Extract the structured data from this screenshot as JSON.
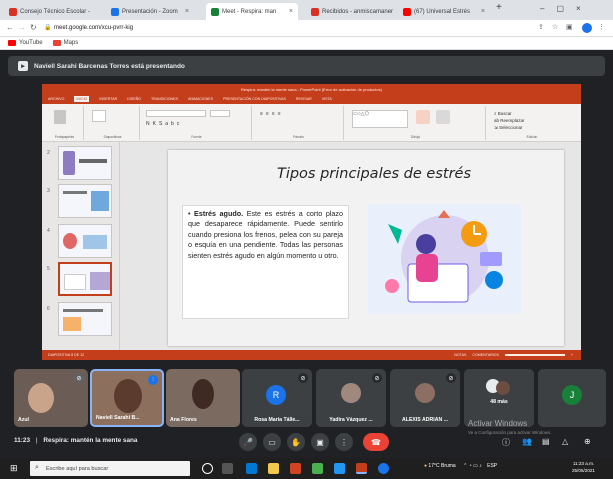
{
  "browser": {
    "tabs": [
      {
        "label": "Consejo Técnico Escolar - ",
        "favicon_color": "#d93025"
      },
      {
        "label": "Presentación - Zoom",
        "favicon_color": "#1a73e8"
      },
      {
        "label": "Meet - Respira: man",
        "favicon_color": "#188038"
      },
      {
        "label": "Recibidos - anmiscamaner",
        "favicon_color": "#d93025"
      },
      {
        "label": "(67) Universal Estrés",
        "favicon_color": "#ff0000"
      }
    ],
    "new_tab": "+",
    "url": "meet.google.com/xcu-pvrr-kig",
    "bookmarks": [
      {
        "label": "YouTube",
        "icon": "youtube-icon"
      },
      {
        "label": "Maps",
        "icon": "gmail-icon"
      }
    ]
  },
  "meet": {
    "presenter_banner": "Naviell Sarahi Barcenas Torres está presentando",
    "meeting_time": "11:23",
    "meeting_name": "Respira: mantén la mente sana",
    "participants": [
      {
        "name": "Azul",
        "type": "video",
        "muted": true
      },
      {
        "name": "Naviell Sarahí B...",
        "type": "video",
        "muted": false
      },
      {
        "name": "Ana Flores",
        "type": "video",
        "muted": false
      },
      {
        "name": "Rosa Maria Tálle...",
        "type": "avatar",
        "letter": "R",
        "color": "#1a73e8",
        "muted": true
      },
      {
        "name": "Yadira Vázquez ...",
        "type": "photo",
        "muted": true
      },
      {
        "name": "ALEXIS ADRIAN ...",
        "type": "photo",
        "muted": true
      },
      {
        "name": "48 más",
        "type": "more",
        "muted": false
      },
      {
        "name": "",
        "type": "avatar",
        "letter": "J",
        "color": "#188038",
        "muted": false
      }
    ],
    "activation_watermark": "Activar Windows",
    "activation_sub": "Ve a Configuración para activar Windows."
  },
  "ppt": {
    "title_bar": "Respira: mantén la mente sana - PowerPoint (Error de activación de productos)",
    "tabs": [
      "ARCHIVO",
      "INICIO",
      "INSERTAR",
      "DISEÑO",
      "TRANSICIONES",
      "ANIMACIONES",
      "PRESENTACIÓN CON DIAPOSITIVAS",
      "REVISAR",
      "VISTA"
    ],
    "ribbon_groups": [
      "Portapapeles",
      "Diapositivas",
      "Fuente",
      "Párrafo",
      "Dibujo",
      "Edición"
    ],
    "slide_numbers": [
      "2",
      "3",
      "4",
      "5",
      "6"
    ],
    "status": "DIAPOSITIVA 5 DE 12",
    "status_right": "NOTAS",
    "status_comments": "COMENTARIOS",
    "zoom": "+"
  },
  "slide": {
    "title": "Tipos principales de estrés",
    "bullet_bold": "Estrés agudo.",
    "bullet_text": " Este es estrés a corto plazo que desaparece rápidamente. Puede sentirlo cuando presiona los frenos, pelea con su pareja o esquía en una pendiente. Todas las personas sienten estrés agudo en algún momento u otro."
  },
  "taskbar": {
    "search_placeholder": "Escribe aquí para buscar",
    "weather": "17°C Bruma",
    "language": "ESP",
    "time": "11:23 a.m.",
    "date": "25/05/2021"
  }
}
